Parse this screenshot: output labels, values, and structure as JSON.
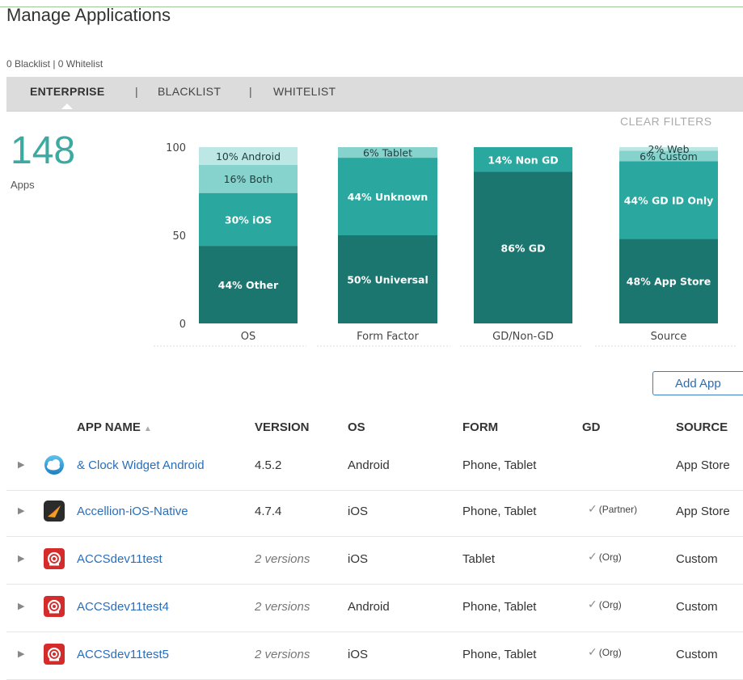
{
  "page": {
    "title": "Manage Applications",
    "list_summary": "0 Blacklist | 0 Whitelist"
  },
  "tabs": [
    {
      "label": "ENTERPRISE",
      "active": true
    },
    {
      "label": "BLACKLIST",
      "active": false
    },
    {
      "label": "WHITELIST",
      "active": false
    }
  ],
  "tab_separator": "|",
  "filters": {
    "clear_label": "CLEAR FILTERS"
  },
  "summary": {
    "count": "148",
    "label": "Apps"
  },
  "colors": {
    "level1": "#1b7670",
    "level2": "#2aa79e",
    "level3": "#86d3ce",
    "level4": "#bce7e4",
    "accent": "#3daaa2",
    "link": "#2a6ebb"
  },
  "chart_data": {
    "type": "bar",
    "stacked": true,
    "categories": [
      "OS",
      "Form Factor",
      "GD/Non-GD",
      "Source"
    ],
    "ylim": [
      0,
      100
    ],
    "yticks": [
      0,
      50,
      100
    ],
    "grid": false,
    "stacks": [
      [
        {
          "label": "44% Other",
          "value": 44,
          "color": "#1b7670"
        },
        {
          "label": "30% iOS",
          "value": 30,
          "color": "#2aa79e"
        },
        {
          "label": "16% Both",
          "value": 16,
          "color": "#86d3ce"
        },
        {
          "label": "10% Android",
          "value": 10,
          "color": "#bce7e4"
        }
      ],
      [
        {
          "label": "50% Universal",
          "value": 50,
          "color": "#1b7670"
        },
        {
          "label": "44% Unknown",
          "value": 44,
          "color": "#2aa79e"
        },
        {
          "label": "6% Tablet",
          "value": 6,
          "color": "#86d3ce"
        }
      ],
      [
        {
          "label": "86% GD",
          "value": 86,
          "color": "#1b7670"
        },
        {
          "label": "14% Non GD",
          "value": 14,
          "color": "#2aa79e"
        }
      ],
      [
        {
          "label": "48% App Store",
          "value": 48,
          "color": "#1b7670"
        },
        {
          "label": "44% GD ID Only",
          "value": 44,
          "color": "#2aa79e"
        },
        {
          "label": "6% Custom",
          "value": 6,
          "color": "#86d3ce"
        },
        {
          "label": "2% Web",
          "value": 2,
          "color": "#bce7e4"
        }
      ]
    ]
  },
  "toolbar": {
    "add_app_label": "Add App"
  },
  "table": {
    "headers": {
      "name": "APP NAME",
      "version": "VERSION",
      "os": "OS",
      "form": "FORM",
      "gd": "GD",
      "source": "SOURCE"
    },
    "sort_indicator": "▲",
    "rows": [
      {
        "icon": "weather-clock-widget-icon",
        "name": "& Clock Widget Android",
        "version": "4.5.2",
        "version_multi": false,
        "os": "Android",
        "form": "Phone, Tablet",
        "gd": false,
        "gd_note": "",
        "source": "App Store"
      },
      {
        "icon": "accellion-app-icon",
        "name": "Accellion-iOS-Native",
        "version": "4.7.4",
        "version_multi": false,
        "os": "iOS",
        "form": "Phone, Tablet",
        "gd": true,
        "gd_note": "(Partner)",
        "source": "App Store"
      },
      {
        "icon": "good-app-icon",
        "name": "ACCSdev11test",
        "version": "2 versions",
        "version_multi": true,
        "os": "iOS",
        "form": "Tablet",
        "gd": true,
        "gd_note": "(Org)",
        "source": "Custom"
      },
      {
        "icon": "good-app-icon",
        "name": "ACCSdev11test4",
        "version": "2 versions",
        "version_multi": true,
        "os": "Android",
        "form": "Phone, Tablet",
        "gd": true,
        "gd_note": "(Org)",
        "source": "Custom"
      },
      {
        "icon": "good-app-icon",
        "name": "ACCSdev11test5",
        "version": "2 versions",
        "version_multi": true,
        "os": "iOS",
        "form": "Phone, Tablet",
        "gd": true,
        "gd_note": "(Org)",
        "source": "Custom"
      }
    ]
  }
}
